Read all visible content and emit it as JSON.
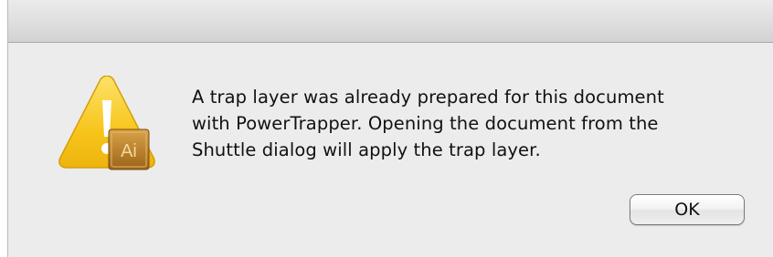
{
  "dialog": {
    "message_lines": [
      "A trap layer was already prepared for this document",
      "with PowerTrapper. Opening the document from the",
      "Shuttle dialog will apply the trap layer."
    ],
    "ok_label": "OK"
  },
  "icons": {
    "alert": "warning-triangle-icon",
    "app_badge": "illustrator-app-icon",
    "app_badge_text": "Ai"
  },
  "colors": {
    "warning_yellow": "#f7c51b",
    "app_badge": "#b8791f"
  }
}
